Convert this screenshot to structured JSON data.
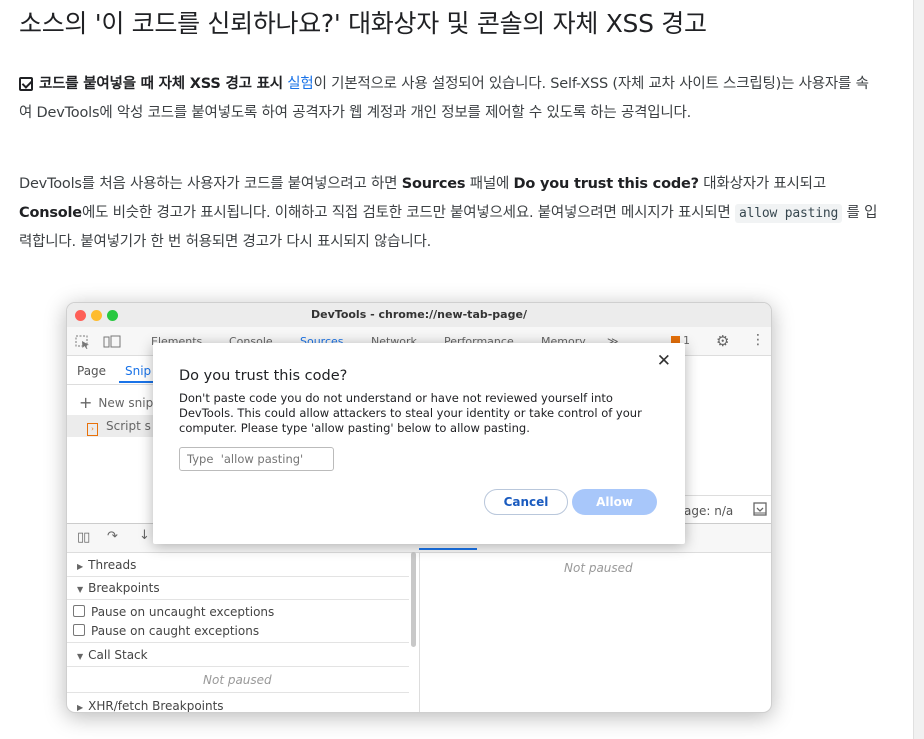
{
  "heading": "소스의 '이 코드를 신뢰하나요?' 대화상자 및 콘솔의 자체 XSS 경고",
  "para1": {
    "bold": "코드를 붙여넣을 때 자체 XSS 경고 표시",
    "link": "실험",
    "rest": "이 기본적으로 사용 설정되어 있습니다. Self-XSS (자체 교차 사이트 스크립팅)는 사용자를 속여 DevTools에 악성 코드를 붙여넣도록 하여 공격자가 웹 계정과 개인 정보를 제어할 수 있도록 하는 공격입니다."
  },
  "para2": {
    "t1": "DevTools를 처음 사용하는 사용자가 코드를 붙여넣으려고 하면 ",
    "b1": "Sources",
    "t2": " 패널에 ",
    "b2": "Do you trust this code?",
    "t3": " 대화상자가 표시되고 ",
    "b3": "Console",
    "t4": "에도 비슷한 경고가 표시됩니다. 이해하고 직접 검토한 코드만 붙여넣으세요. 붙여넣으려면 메시지가 표시되면 ",
    "code": "allow pasting",
    "t5": " 를 입력합니다. 붙여넣기가 한 번 허용되면 경고가 다시 표시되지 않습니다."
  },
  "devtools": {
    "window_title": "DevTools - chrome://new-tab-page/",
    "toolbar_tabs": [
      "Elements",
      "Console",
      "Sources",
      "Network",
      "Performance",
      "Memory",
      "≫"
    ],
    "issue_count": "1",
    "subtabs": [
      "Page",
      "Snip"
    ],
    "new_snippet": "New snip",
    "script_snippet": "Script s",
    "page_status": "age: n/a",
    "sections": {
      "threads": "Threads",
      "breakpoints": "Breakpoints",
      "pause_uncaught": "Pause on uncaught exceptions",
      "pause_caught": "Pause on caught exceptions",
      "call_stack": "Call Stack",
      "not_paused": "Not paused",
      "xhr": "XHR/fetch Breakpoints",
      "right_not_paused": "Not paused"
    }
  },
  "dialog": {
    "title": "Do you trust this code?",
    "body": "Don't paste code you do not understand or have not reviewed yourself into DevTools. This could allow attackers to steal your identity or take control of your computer. Please type 'allow pasting' below to allow pasting.",
    "input_placeholder": "Type  'allow pasting'",
    "cancel": "Cancel",
    "allow": "Allow",
    "close": "✕"
  }
}
